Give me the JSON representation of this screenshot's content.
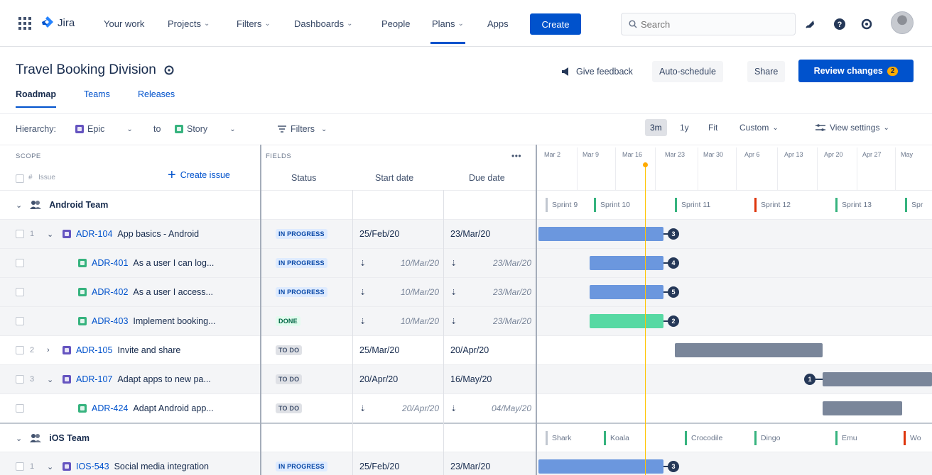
{
  "nav": {
    "logo_text": "Jira",
    "items": [
      {
        "label": "Your work",
        "dropdown": false
      },
      {
        "label": "Projects",
        "dropdown": true
      },
      {
        "label": "Filters",
        "dropdown": true
      },
      {
        "label": "Dashboards",
        "dropdown": true
      },
      {
        "label": "People",
        "dropdown": false
      },
      {
        "label": "Plans",
        "dropdown": true,
        "active": true
      },
      {
        "label": "Apps",
        "dropdown": false
      }
    ],
    "create_label": "Create",
    "search_placeholder": "Search"
  },
  "header": {
    "title": "Travel Booking Division",
    "give_feedback": "Give feedback",
    "auto_schedule": "Auto-schedule",
    "share": "Share",
    "review_changes": "Review changes",
    "review_count": "2"
  },
  "tabs": [
    "Roadmap",
    "Teams",
    "Releases"
  ],
  "toolbar": {
    "hierarchy_label": "Hierarchy:",
    "from_level": "Epic",
    "to_label": "to",
    "to_level": "Story",
    "filters_label": "Filters",
    "zoom": [
      "3m",
      "1y",
      "Fit"
    ],
    "zoom_selected": "3m",
    "custom_label": "Custom",
    "view_settings_label": "View settings"
  },
  "columns": {
    "scope_label": "SCOPE",
    "fields_label": "FIELDS",
    "more": "•••",
    "hash": "#",
    "issue": "Issue",
    "create_issue": "Create issue",
    "status": "Status",
    "start_date": "Start date",
    "due_date": "Due date"
  },
  "timeline_dates": [
    "Mar 2",
    "Mar 9",
    "Mar 16",
    "Mar 23",
    "Mar 30",
    "Apr 6",
    "Apr 13",
    "Apr 20",
    "Apr 27",
    "May"
  ],
  "groups": [
    {
      "name": "Android Team",
      "sprints": [
        {
          "name": "Sprint 9",
          "color": "#c1c7d0"
        },
        {
          "name": "Sprint 10",
          "color": "#36b37e"
        },
        {
          "name": "Sprint 11",
          "color": "#36b37e"
        },
        {
          "name": "Sprint 12",
          "color": "#de350b"
        },
        {
          "name": "Sprint 13",
          "color": "#36b37e"
        },
        {
          "name": "Spr",
          "color": "#36b37e"
        }
      ]
    },
    {
      "name": "iOS Team",
      "sprints": [
        {
          "name": "Shark",
          "color": "#c1c7d0"
        },
        {
          "name": "Koala",
          "color": "#36b37e"
        },
        {
          "name": "Crocodile",
          "color": "#36b37e"
        },
        {
          "name": "Dingo",
          "color": "#36b37e"
        },
        {
          "name": "Emu",
          "color": "#36b37e"
        },
        {
          "name": "Wo",
          "color": "#de350b"
        }
      ]
    }
  ],
  "rows": [
    {
      "num": "1",
      "expand": "open",
      "type": "epic",
      "key": "ADR-104",
      "summary": "App basics - Android",
      "status": "IN PROGRESS",
      "status_kind": "prog",
      "start": "25/Feb/20",
      "due": "23/Mar/20",
      "inherited": false,
      "bar_color": "blue",
      "dep": "3"
    },
    {
      "num": "",
      "expand": "",
      "type": "story",
      "key": "ADR-401",
      "summary": "As a user I can log...",
      "status": "IN PROGRESS",
      "status_kind": "prog",
      "start": "10/Mar/20",
      "due": "23/Mar/20",
      "inherited": true,
      "bar_color": "blue",
      "dep": "4"
    },
    {
      "num": "",
      "expand": "",
      "type": "story",
      "key": "ADR-402",
      "summary": "As a user I access...",
      "status": "IN PROGRESS",
      "status_kind": "prog",
      "start": "10/Mar/20",
      "due": "23/Mar/20",
      "inherited": true,
      "bar_color": "blue",
      "dep": "5"
    },
    {
      "num": "",
      "expand": "",
      "type": "story",
      "key": "ADR-403",
      "summary": "Implement booking...",
      "status": "DONE",
      "status_kind": "done",
      "start": "10/Mar/20",
      "due": "23/Mar/20",
      "inherited": true,
      "bar_color": "green",
      "dep": "2"
    },
    {
      "num": "2",
      "expand": "closed",
      "type": "epic",
      "key": "ADR-105",
      "summary": "Invite and share",
      "status": "TO DO",
      "status_kind": "todo",
      "start": "25/Mar/20",
      "due": "20/Apr/20",
      "inherited": false,
      "bar_color": "gray",
      "dep": ""
    },
    {
      "num": "3",
      "expand": "open",
      "type": "epic",
      "key": "ADR-107",
      "summary": "Adapt apps to new pa...",
      "status": "TO DO",
      "status_kind": "todo",
      "start": "20/Apr/20",
      "due": "16/May/20",
      "inherited": false,
      "bar_color": "gray",
      "dep": "1"
    },
    {
      "num": "",
      "expand": "",
      "type": "story",
      "key": "ADR-424",
      "summary": "Adapt Android app...",
      "status": "TO DO",
      "status_kind": "todo",
      "start": "20/Apr/20",
      "due": "04/May/20",
      "inherited": true,
      "bar_color": "gray",
      "dep": ""
    },
    {
      "num": "1",
      "expand": "open",
      "type": "epic",
      "key": "IOS-543",
      "summary": "Social media integration",
      "status": "IN PROGRESS",
      "status_kind": "prog",
      "start": "25/Feb/20",
      "due": "23/Mar/20",
      "inherited": false,
      "bar_color": "blue",
      "dep": "3"
    }
  ]
}
